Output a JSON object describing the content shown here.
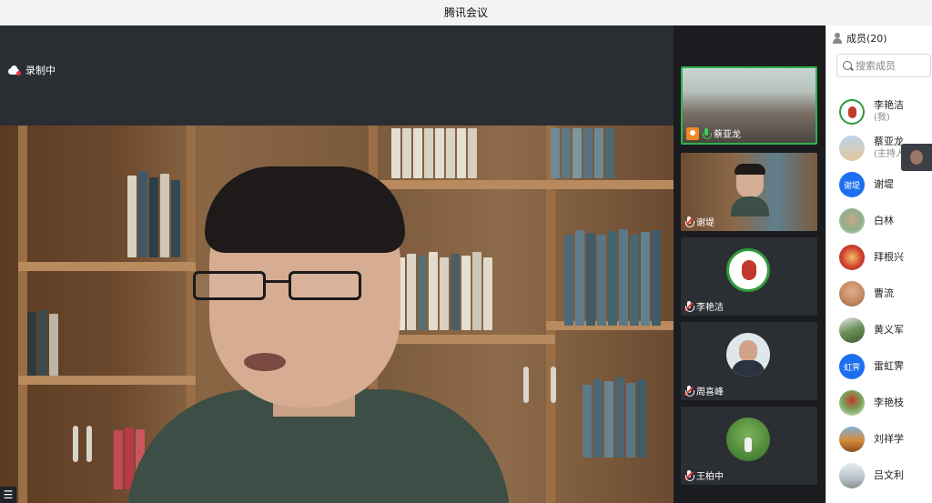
{
  "window": {
    "title": "腾讯会议"
  },
  "stage": {
    "recording_label": "录制中"
  },
  "thumbnails": [
    {
      "name": "蔡亚龙",
      "mic": "on",
      "host": true,
      "type": "video"
    },
    {
      "name": "谢堤",
      "mic": "off",
      "host": false,
      "type": "video"
    },
    {
      "name": "李艳洁",
      "mic": "off",
      "host": false,
      "type": "avatar"
    },
    {
      "name": "周喜峰",
      "mic": "off",
      "host": false,
      "type": "avatar"
    },
    {
      "name": "王柏中",
      "mic": "off",
      "host": false,
      "type": "avatar"
    }
  ],
  "panel": {
    "members_label": "成员(20)",
    "search_placeholder": "搜索成员",
    "members": [
      {
        "name": "李艳洁",
        "sub": "(我)",
        "avatar_text": "",
        "avatar_color": "#e8f4e8"
      },
      {
        "name": "蔡亚龙",
        "sub": "(主持人)",
        "avatar_text": "",
        "avatar_color": "#c9dce9"
      },
      {
        "name": "谢堤",
        "sub": "",
        "avatar_text": "谢堤",
        "avatar_color": "#1e6ff0"
      },
      {
        "name": "白林",
        "sub": "",
        "avatar_text": "",
        "avatar_color": "#8fb08a"
      },
      {
        "name": "拜根兴",
        "sub": "",
        "avatar_text": "",
        "avatar_color": "#c0392b"
      },
      {
        "name": "曹流",
        "sub": "",
        "avatar_text": "",
        "avatar_color": "#c58a62"
      },
      {
        "name": "黄义军",
        "sub": "",
        "avatar_text": "",
        "avatar_color": "#6b8f57"
      },
      {
        "name": "雷虹霁",
        "sub": "",
        "avatar_text": "虹霁",
        "avatar_color": "#1e6ff0"
      },
      {
        "name": "李艳枝",
        "sub": "",
        "avatar_text": "",
        "avatar_color": "#7aa65c"
      },
      {
        "name": "刘祥学",
        "sub": "",
        "avatar_text": "",
        "avatar_color": "#d58a3a"
      },
      {
        "name": "吕文利",
        "sub": "",
        "avatar_text": "",
        "avatar_color": "#b7c3cb"
      }
    ]
  },
  "colors": {
    "accent_green": "#2fb24a",
    "accent_blue": "#1e6ff0"
  }
}
